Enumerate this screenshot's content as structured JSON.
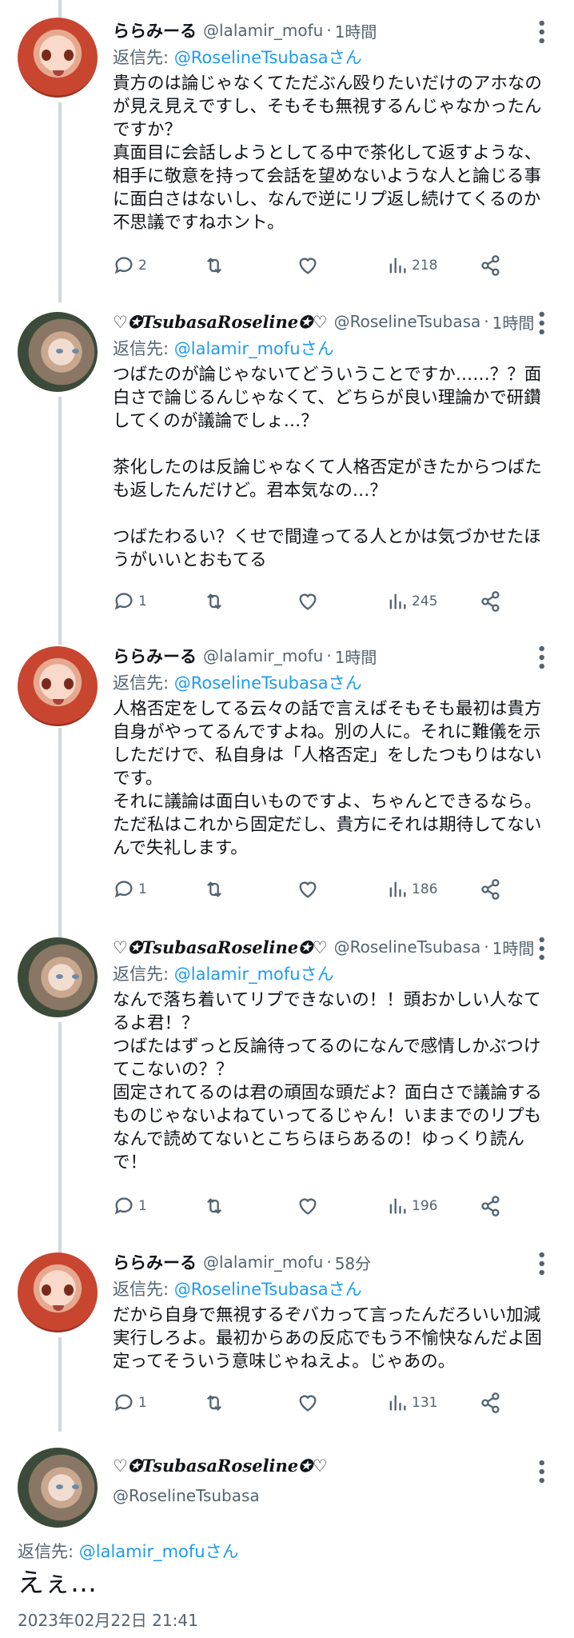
{
  "tweets": [
    {
      "name": "ららみーる",
      "handle": "@lalamir_mofu",
      "dot": "·",
      "time": "1時間",
      "reply_prefix": "返信先: ",
      "reply_mention": "@RoselineTsubasaさん",
      "text": "貴方のは論じゃなくてただぶん殴りたいだけのアホなのが見え見えですし、そもそも無視するんじゃなかったんですか？\n真面目に会話しようとしてる中で茶化して返すような、相手に敬意を持って会話を望めないような人と論じる事に面白さはないし、なんで逆にリプ返し続けてくるのか不思議ですねホント。",
      "replies": "2",
      "views": "218"
    },
    {
      "name": "♡✪TsubasaRoseline✪♡",
      "handle": "@RoselineTsubasa",
      "dot": "·",
      "time": "1時間",
      "reply_prefix": "返信先: ",
      "reply_mention": "@lalamir_mofuさん",
      "text": "つばたのが論じゃないてどういうことですか……？？面白さで論じるんじゃなくて、どちらが良い理論かで研鑽してくのが議論でしょ…？\n\n茶化したのは反論じゃなくて人格否定がきたからつばたも返したんだけど。君本気なの…？\n\nつばたわるい？くせで間違ってる人とかは気づかせたほうがいいとおもてる",
      "replies": "1",
      "views": "245"
    },
    {
      "name": "ららみーる",
      "handle": "@lalamir_mofu",
      "dot": "·",
      "time": "1時間",
      "reply_prefix": "返信先: ",
      "reply_mention": "@RoselineTsubasaさん",
      "text": "人格否定をしてる云々の話で言えばそもそも最初は貴方自身がやってるんですよね。別の人に。それに難儀を示しただけで、私自身は「人格否定」をしたつもりはないです。\nそれに議論は面白いものですよ、ちゃんとできるなら。ただ私はこれから固定だし、貴方にそれは期待してないんで失礼します。",
      "replies": "1",
      "views": "186"
    },
    {
      "name": "♡✪TsubasaRoseline✪♡",
      "handle": "@RoselineTsubasa",
      "dot": "·",
      "time": "1時間",
      "reply_prefix": "返信先: ",
      "reply_mention": "@lalamir_mofuさん",
      "text": "なんで落ち着いてリプできないの！！頭おかしい人なてるよ君！？\nつばたはずっと反論待ってるのになんで感情しかぶつけてこないの？？\n固定されてるのは君の頑固な頭だよ？面白さで議論するものじゃないよねていってるじゃん！いままでのリプもなんで読めてないとこちらほらあるの！ゆっくり読んで！",
      "replies": "1",
      "views": "196"
    },
    {
      "name": "ららみーる",
      "handle": "@lalamir_mofu",
      "dot": "·",
      "time": "58分",
      "reply_prefix": "返信先: ",
      "reply_mention": "@RoselineTsubasaさん",
      "text": "だから自身で無視するぞバカって言ったんだろいい加減実行しろよ。最初からあの反応でもう不愉快なんだよ固定ってそういう意味じゃねえよ。じゃあの。",
      "replies": "1",
      "views": "131"
    }
  ],
  "main": {
    "name": "♡✪TsubasaRoseline✪♡",
    "handle": "@RoselineTsubasa",
    "reply_prefix": "返信先: ",
    "reply_mention": "@lalamir_mofuさん",
    "text": "えぇ…",
    "date": "2023年02月22日 21:41"
  },
  "icons": {
    "reply": "reply-bubble-icon",
    "retweet": "retweet-icon",
    "like": "heart-icon",
    "views": "views-bar-icon",
    "share": "share-icon",
    "more": "more-dots-icon"
  },
  "colors": {
    "text": "#0f1419",
    "secondary": "#536471",
    "link": "#1d9bf0",
    "thread_line": "#cfd9de"
  }
}
